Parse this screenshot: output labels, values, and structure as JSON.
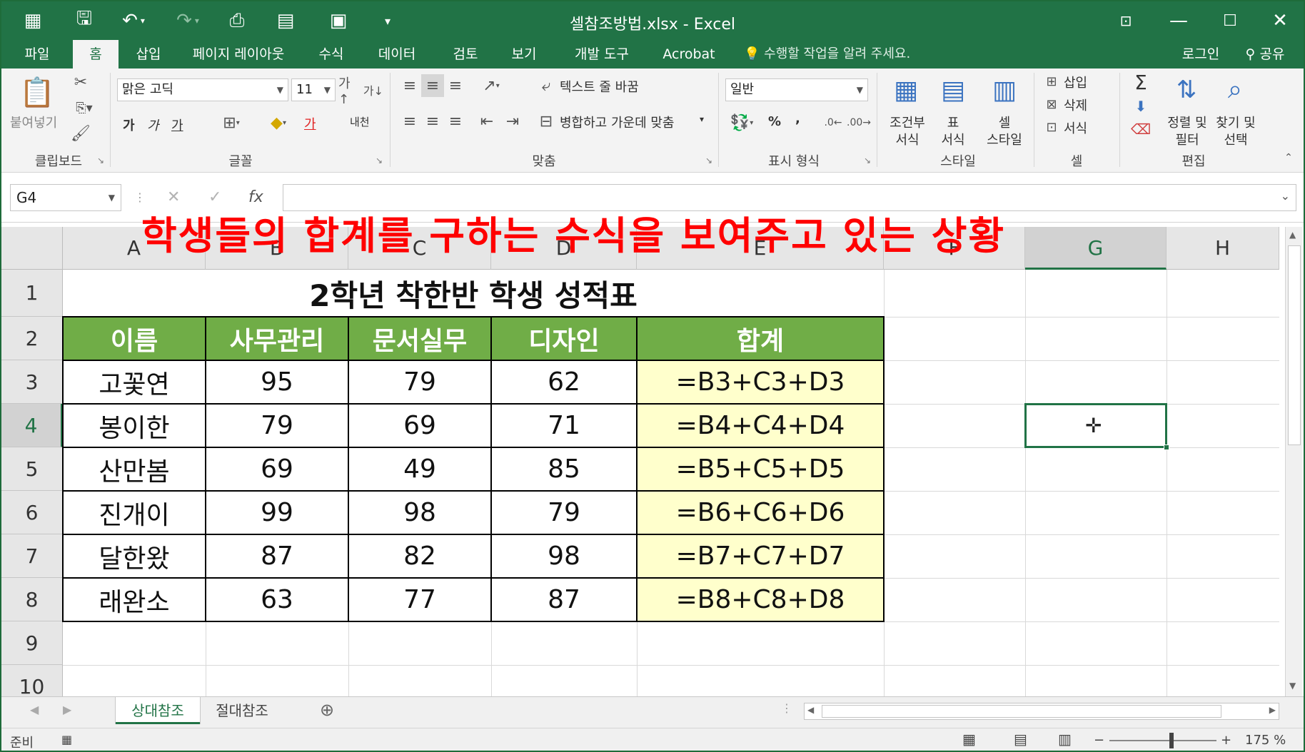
{
  "window": {
    "title": "셀참조방법.xlsx - Excel",
    "quick_access": [
      "spreadsheet-icon",
      "save-icon",
      "undo-icon",
      "redo-icon",
      "print-preview-icon",
      "form-icon",
      "camera-icon",
      "customize-icon"
    ]
  },
  "tabs": [
    {
      "label": "파일",
      "active": false
    },
    {
      "label": "홈",
      "active": true
    },
    {
      "label": "삽입",
      "active": false
    },
    {
      "label": "페이지 레이아웃",
      "active": false
    },
    {
      "label": "수식",
      "active": false
    },
    {
      "label": "데이터",
      "active": false
    },
    {
      "label": "검토",
      "active": false
    },
    {
      "label": "보기",
      "active": false
    },
    {
      "label": "개발 도구",
      "active": false
    },
    {
      "label": "Acrobat",
      "active": false
    }
  ],
  "tell_me": "수행할 작업을 알려 주세요.",
  "account": {
    "login": "로그인",
    "share": "공유"
  },
  "ribbon": {
    "clipboard": {
      "paste": "붙여넣기",
      "label": "클립보드"
    },
    "font": {
      "name": "맑은 고딕",
      "size": "11",
      "bold": "가",
      "italic": "가",
      "underline": "가",
      "font_color": "가",
      "phonetic": "내천",
      "label": "글꼴"
    },
    "alignment": {
      "wrap": "텍스트 줄 바꿈",
      "merge": "병합하고 가운데 맞춤",
      "label": "맞춤"
    },
    "number": {
      "format": "일반",
      "percent": "%",
      "comma": ",",
      "label": "표시 형식"
    },
    "styles": {
      "conditional": "조건부\n서식",
      "table": "표\n서식",
      "cell": "셀\n스타일",
      "conditional_l1": "조건부",
      "conditional_l2": "서식",
      "table_l1": "표",
      "table_l2": "서식",
      "cell_l1": "셀",
      "cell_l2": "스타일",
      "label": "스타일"
    },
    "cells": {
      "insert": "삽입",
      "delete": "삭제",
      "format": "서식",
      "label": "셀"
    },
    "editing": {
      "sort_l1": "정렬 및",
      "sort_l2": "필터",
      "find_l1": "찾기 및",
      "find_l2": "선택",
      "label": "편집"
    }
  },
  "formula_bar": {
    "name_box": "G4",
    "cancel": "✕",
    "enter": "✓",
    "fx": "fx",
    "value": ""
  },
  "overlay_caption": "학생들의 합계를 구하는 수식을 보여주고 있는 상황",
  "columns": [
    "A",
    "B",
    "C",
    "D",
    "E",
    "F",
    "G",
    "H"
  ],
  "rows": [
    "1",
    "2",
    "3",
    "4",
    "5",
    "6",
    "7",
    "8",
    "9",
    "10"
  ],
  "sheet": {
    "title": "2학년 착한반 학생 성적표",
    "headers": [
      "이름",
      "사무관리",
      "문서실무",
      "디자인",
      "합계"
    ],
    "data": [
      [
        "고꽃연",
        "95",
        "79",
        "62",
        "=B3+C3+D3"
      ],
      [
        "봉이한",
        "79",
        "69",
        "71",
        "=B4+C4+D4"
      ],
      [
        "산만봄",
        "69",
        "49",
        "85",
        "=B5+C5+D5"
      ],
      [
        "진개이",
        "99",
        "98",
        "79",
        "=B6+C6+D6"
      ],
      [
        "달한왔",
        "87",
        "82",
        "98",
        "=B7+C7+D7"
      ],
      [
        "래완소",
        "63",
        "77",
        "87",
        "=B8+C8+D8"
      ]
    ],
    "selected_cell": "G4"
  },
  "sheet_tabs": [
    {
      "label": "상대참조",
      "active": true
    },
    {
      "label": "절대참조",
      "active": false
    }
  ],
  "status": {
    "ready": "준비",
    "zoom": "175 %"
  },
  "colors": {
    "brand": "#217346",
    "header_fill": "#70ad47",
    "formula_fill": "#ffffcc",
    "overlay": "#ff0000"
  }
}
